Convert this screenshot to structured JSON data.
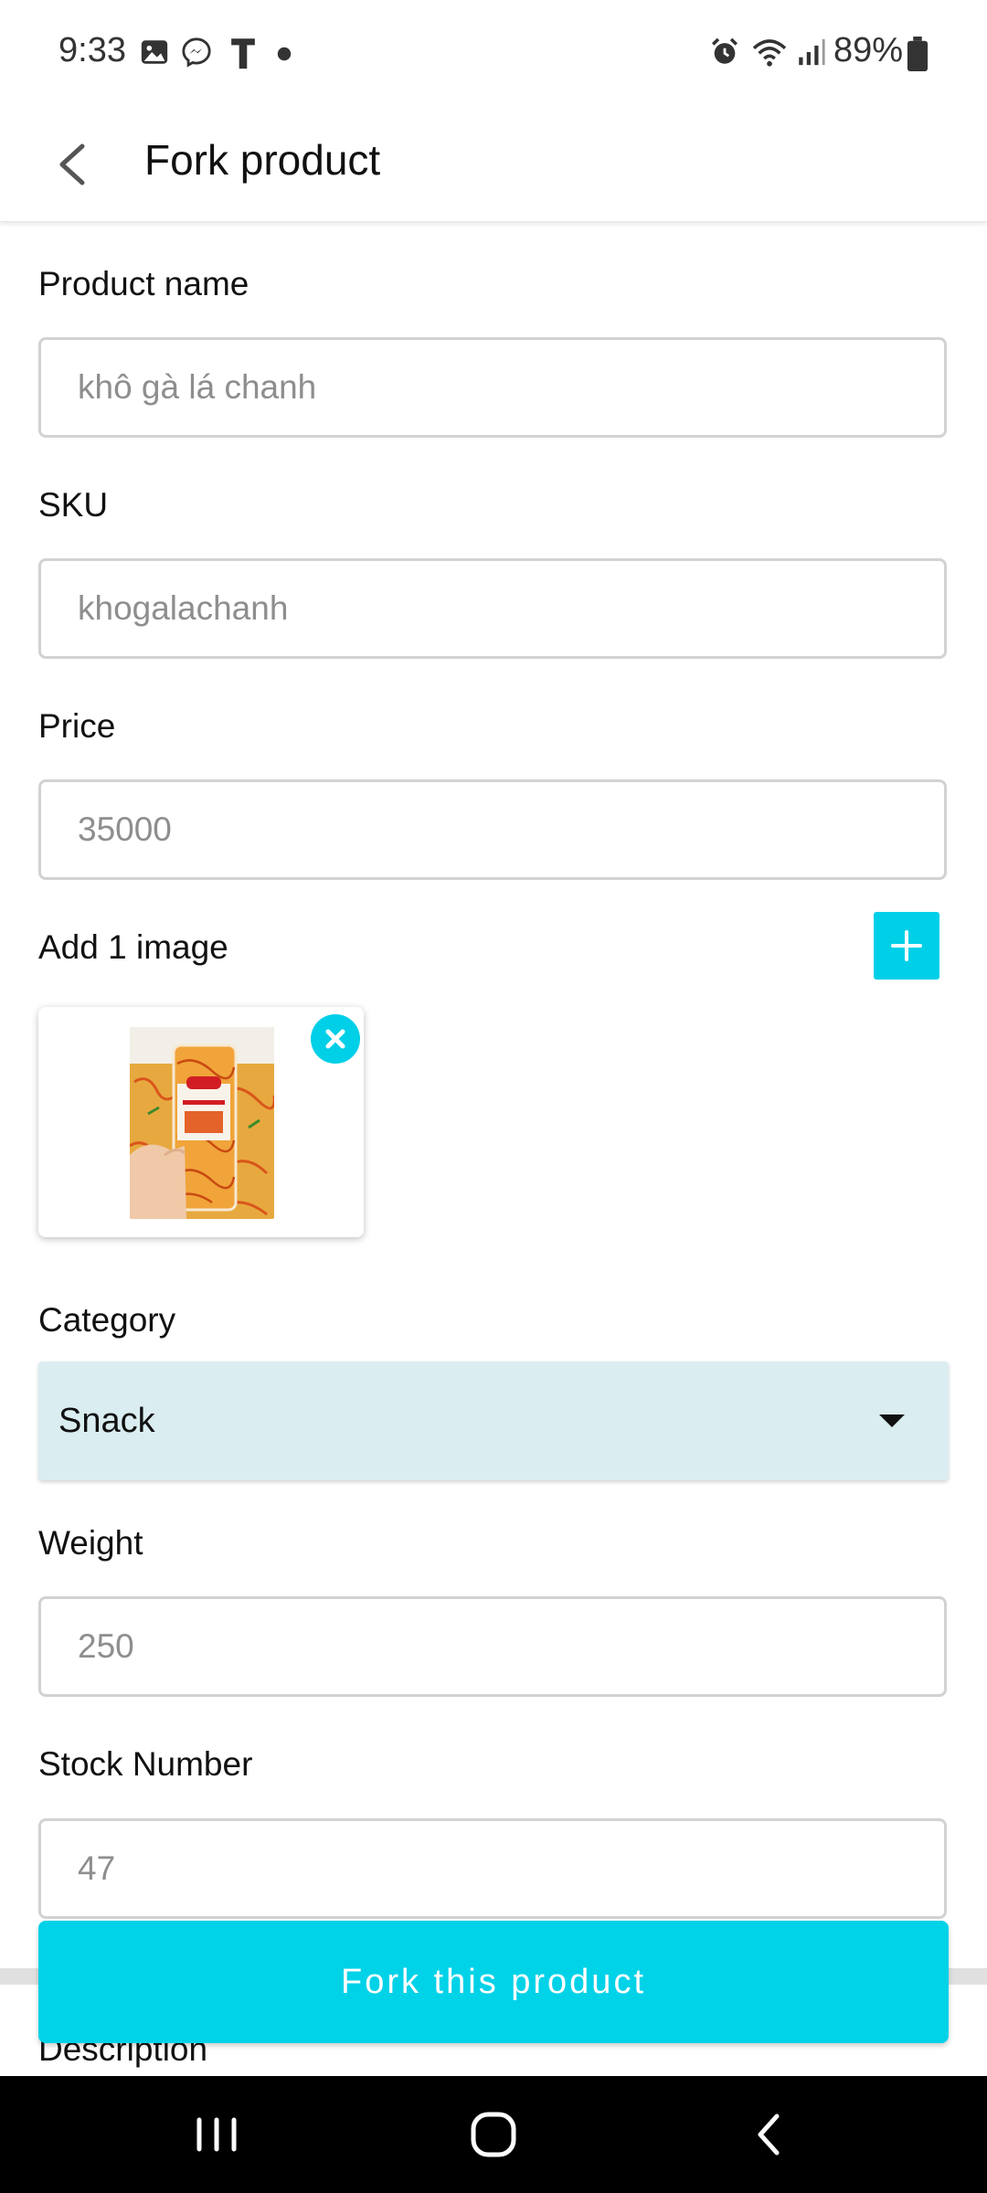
{
  "status_bar": {
    "time": "9:33",
    "battery": "89%",
    "left_icons": [
      "gallery-icon",
      "messenger-icon",
      "t-app-icon",
      "dot-icon"
    ],
    "right_icons": [
      "alarm-icon",
      "wifi-icon",
      "signal-icon",
      "battery-icon"
    ]
  },
  "app_bar": {
    "title": "Fork product",
    "back_icon": "back-arrow-icon"
  },
  "form": {
    "product_name": {
      "label": "Product name",
      "placeholder": "khô gà lá chanh"
    },
    "sku": {
      "label": "SKU",
      "placeholder": "khogalachanh"
    },
    "price": {
      "label": "Price",
      "placeholder": "35000"
    },
    "images": {
      "label": "Add 1 image",
      "add_icon": "plus-icon",
      "remove_icon": "close-icon"
    },
    "category": {
      "label": "Category",
      "value": "Snack"
    },
    "weight": {
      "label": "Weight",
      "placeholder": "250"
    },
    "stock": {
      "label": "Stock Number",
      "placeholder": "47"
    },
    "description": {
      "label": "Description"
    }
  },
  "actions": {
    "fork_label": "Fork this product"
  },
  "colors": {
    "accent": "#00d2e8",
    "select_bg": "#daedf1",
    "input_border": "#d2d2d2",
    "placeholder": "#8e8e8e"
  }
}
